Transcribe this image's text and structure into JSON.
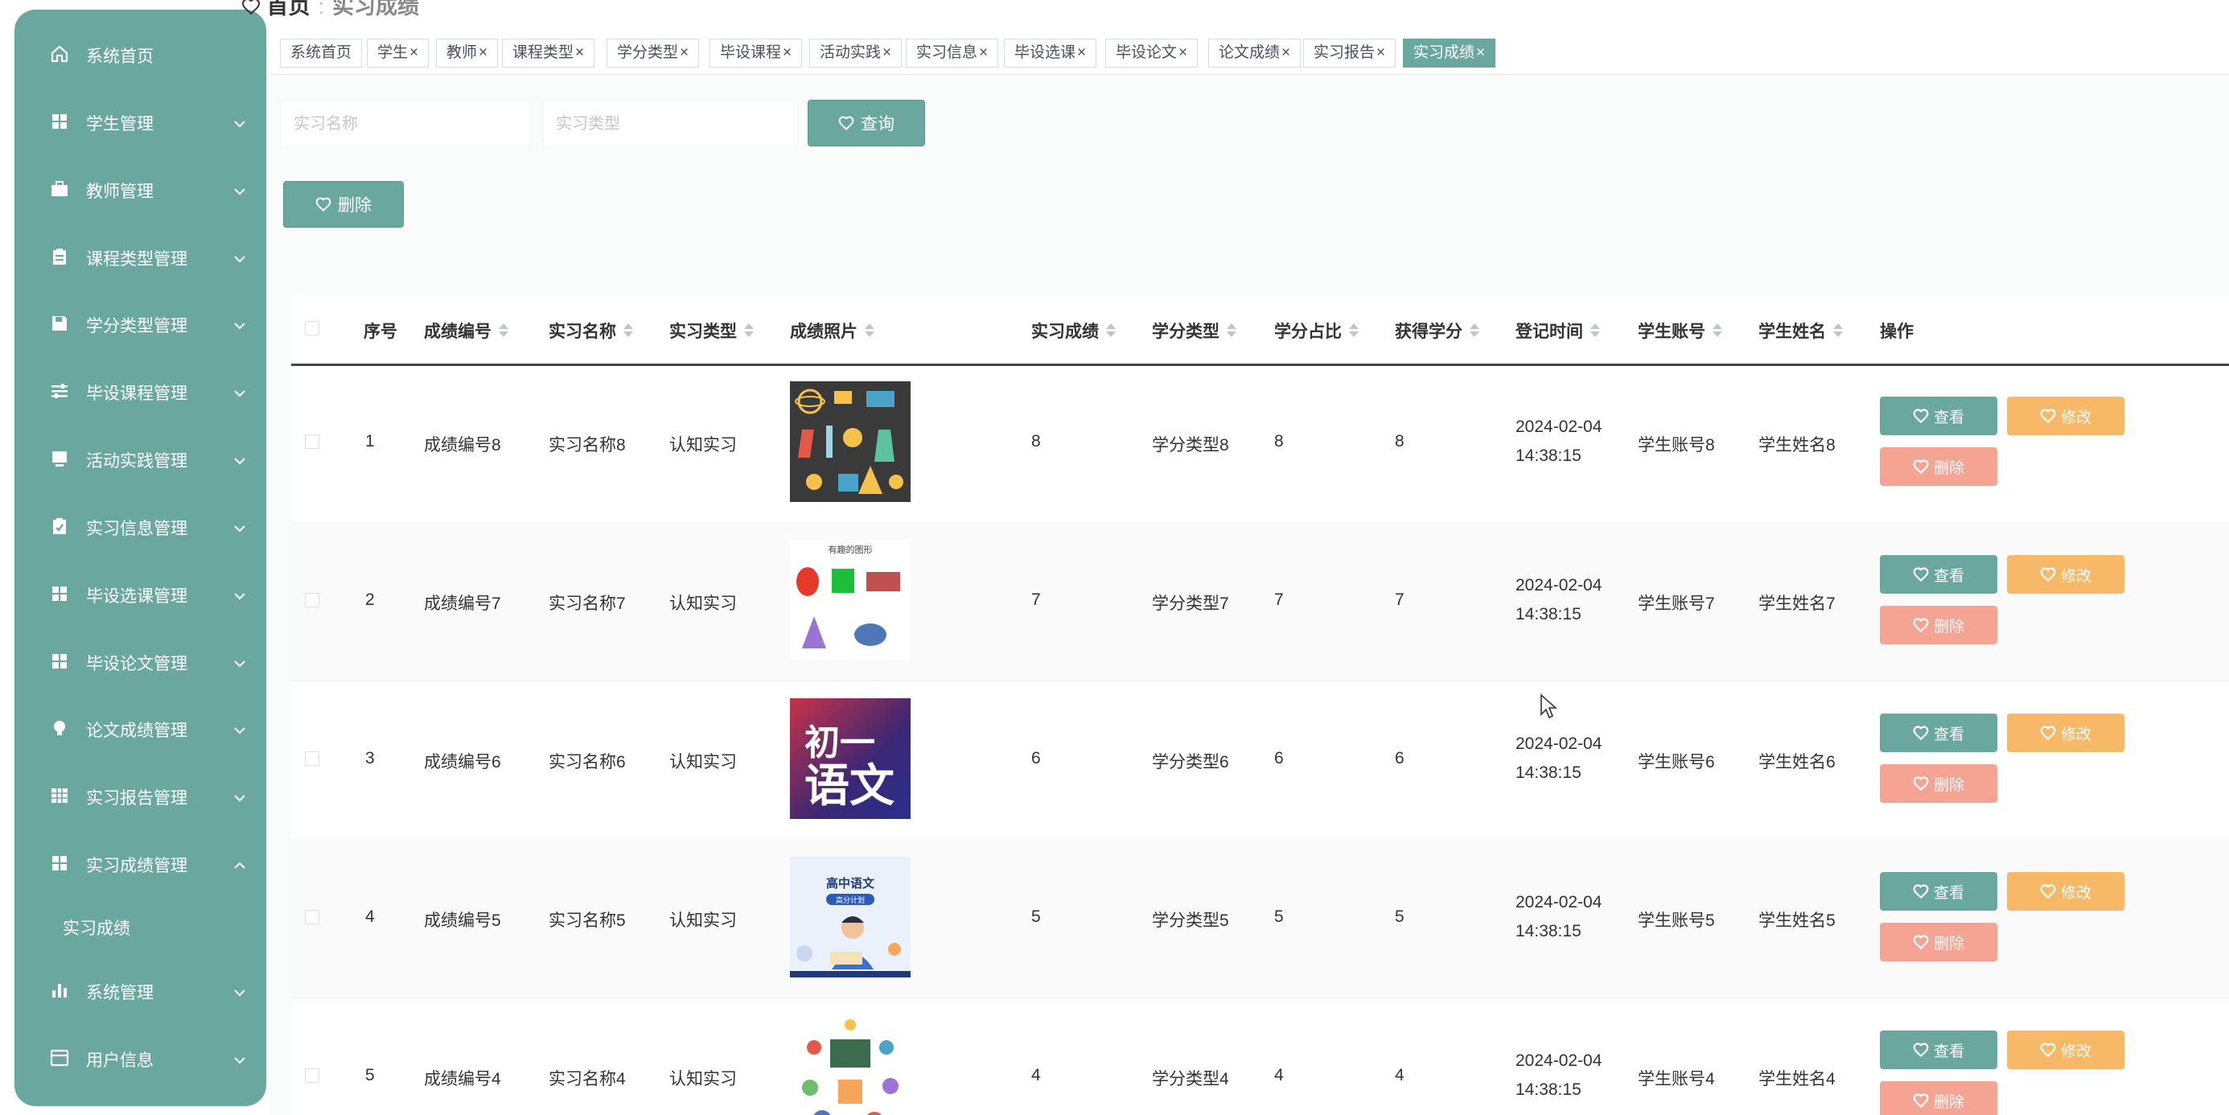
{
  "sidebar": {
    "items": [
      {
        "label": "系统首页",
        "icon": "home-icon",
        "has_arrow": false
      },
      {
        "label": "学生管理",
        "icon": "grid-icon",
        "has_arrow": true
      },
      {
        "label": "教师管理",
        "icon": "briefcase-icon",
        "has_arrow": true
      },
      {
        "label": "课程类型管理",
        "icon": "clipboard-icon",
        "has_arrow": true
      },
      {
        "label": "学分类型管理",
        "icon": "save-icon",
        "has_arrow": true
      },
      {
        "label": "毕设课程管理",
        "icon": "sliders-icon",
        "has_arrow": true
      },
      {
        "label": "活动实践管理",
        "icon": "monitor-icon",
        "has_arrow": true
      },
      {
        "label": "实习信息管理",
        "icon": "clipboard-check-icon",
        "has_arrow": true
      },
      {
        "label": "毕设选课管理",
        "icon": "grid-icon",
        "has_arrow": true
      },
      {
        "label": "毕设论文管理",
        "icon": "grid-icon",
        "has_arrow": true
      },
      {
        "label": "论文成绩管理",
        "icon": "lightbulb-icon",
        "has_arrow": true
      },
      {
        "label": "实习报告管理",
        "icon": "table-icon",
        "has_arrow": true
      },
      {
        "label": "实习成绩管理",
        "icon": "grid-icon",
        "has_arrow": true,
        "expanded": true
      },
      {
        "label": "系统管理",
        "icon": "bar-chart-icon",
        "has_arrow": true
      },
      {
        "label": "用户信息",
        "icon": "window-icon",
        "has_arrow": true
      }
    ],
    "submenu": {
      "label": "实习成绩"
    }
  },
  "breadcrumb": {
    "home": "首页",
    "current": "实习成绩"
  },
  "tags": [
    {
      "label": "系统首页",
      "closable": false
    },
    {
      "label": "学生",
      "closable": true
    },
    {
      "label": "教师",
      "closable": true
    },
    {
      "label": "课程类型",
      "closable": true
    },
    {
      "label": "学分类型",
      "closable": true
    },
    {
      "label": "毕设课程",
      "closable": true
    },
    {
      "label": "活动实践",
      "closable": true
    },
    {
      "label": "实习信息",
      "closable": true
    },
    {
      "label": "毕设选课",
      "closable": true
    },
    {
      "label": "毕设论文",
      "closable": true
    },
    {
      "label": "论文成绩",
      "closable": true
    },
    {
      "label": "实习报告",
      "closable": true
    },
    {
      "label": "实习成绩",
      "closable": true,
      "active": true
    }
  ],
  "tag_close_glyph": "×",
  "search": {
    "name_placeholder": "实习名称",
    "type_placeholder": "实习类型",
    "query_label": "查询"
  },
  "toolbar": {
    "delete_label": "删除"
  },
  "table": {
    "columns": [
      "序号",
      "成绩编号",
      "实习名称",
      "实习类型",
      "成绩照片",
      "实习成绩",
      "学分类型",
      "学分占比",
      "获得学分",
      "登记时间",
      "学生账号",
      "学生姓名",
      "操作"
    ],
    "rows": [
      {
        "index": "1",
        "code": "成绩编号8",
        "name": "实习名称8",
        "type": "认知实习",
        "photo": "science-icons",
        "score": "8",
        "credit_type": "学分类型8",
        "ratio": "8",
        "credit": "8",
        "date": "2024-02-04",
        "time": "14:38:15",
        "account": "学生账号8",
        "student": "学生姓名8"
      },
      {
        "index": "2",
        "code": "成绩编号7",
        "name": "实习名称7",
        "type": "认知实习",
        "photo": "shapes",
        "score": "7",
        "credit_type": "学分类型7",
        "ratio": "7",
        "credit": "7",
        "date": "2024-02-04",
        "time": "14:38:15",
        "account": "学生账号7",
        "student": "学生姓名7"
      },
      {
        "index": "3",
        "code": "成绩编号6",
        "name": "实习名称6",
        "type": "认知实习",
        "photo": "chinese-cover",
        "score": "6",
        "credit_type": "学分类型6",
        "ratio": "6",
        "credit": "6",
        "date": "2024-02-04",
        "time": "14:38:15",
        "account": "学生账号6",
        "student": "学生姓名6"
      },
      {
        "index": "4",
        "code": "成绩编号5",
        "name": "实习名称5",
        "type": "认知实习",
        "photo": "highschool-cover",
        "score": "5",
        "credit_type": "学分类型5",
        "ratio": "5",
        "credit": "5",
        "date": "2024-02-04",
        "time": "14:38:15",
        "account": "学生账号5",
        "student": "学生姓名5"
      },
      {
        "index": "5",
        "code": "成绩编号4",
        "name": "实习名称4",
        "type": "认知实习",
        "photo": "classroom",
        "score": "4",
        "credit_type": "学分类型4",
        "ratio": "4",
        "credit": "4",
        "date": "2024-02-04",
        "time": "14:38:15",
        "account": "学生账号4",
        "student": "学生姓名4"
      }
    ],
    "actions": {
      "view": "查看",
      "edit": "修改",
      "delete": "删除"
    }
  },
  "photo_text": {
    "shapes_title": "有趣的图形",
    "chinese_cover": [
      "初一",
      "语文"
    ],
    "highschool_cover": [
      "高中语文",
      "高分计划"
    ]
  },
  "colors": {
    "primary": "#6aa79e",
    "edit": "#f7b867",
    "delete": "#f5a393"
  }
}
